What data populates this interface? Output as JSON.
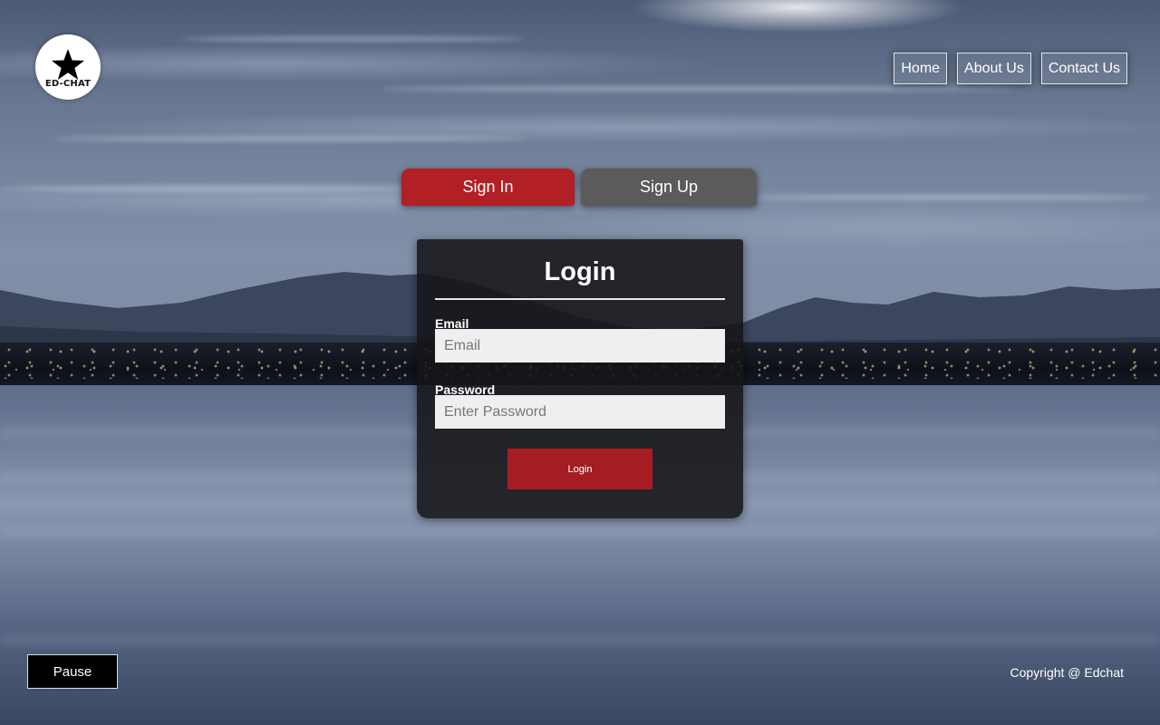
{
  "logo": {
    "text": "ED-CHAT",
    "icon": "star-icon"
  },
  "nav": {
    "items": [
      {
        "label": "Home"
      },
      {
        "label": "About Us"
      },
      {
        "label": "Contact Us"
      }
    ]
  },
  "tabs": {
    "active": "Sign In",
    "items": [
      {
        "label": "Sign In"
      },
      {
        "label": "Sign Up"
      }
    ]
  },
  "login": {
    "title": "Login",
    "email_label": "Email",
    "email_placeholder": "Email",
    "email_value": "",
    "password_label": "Password",
    "password_placeholder": "Enter Password",
    "password_value": "",
    "submit_label": "Login"
  },
  "footer": {
    "pause_label": "Pause",
    "copyright": "Copyright @ Edchat"
  },
  "colors": {
    "accent": "#b21f24",
    "tab_inactive": "#5b5b5b",
    "card": "#161618",
    "input_bg": "#efefef"
  }
}
